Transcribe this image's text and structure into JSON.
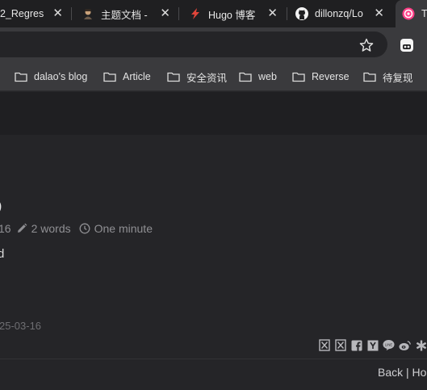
{
  "tabs": [
    {
      "title": "2_Regres",
      "favicon": "none"
    },
    {
      "title": "主题文档 - ",
      "favicon": "avatar-icon"
    },
    {
      "title": "Hugo 博客",
      "favicon": "bolt-icon"
    },
    {
      "title": "dillonzq/Lo",
      "favicon": "github-icon"
    },
    {
      "title": "T",
      "favicon": "hugo-icon"
    }
  ],
  "bookmarks": [
    {
      "label": "dalao's blog"
    },
    {
      "label": "Article"
    },
    {
      "label": "安全资讯"
    },
    {
      "label": "web"
    },
    {
      "label": "Reverse"
    },
    {
      "label": "待复现"
    }
  ],
  "post": {
    "title_fragment": ")",
    "meta": {
      "date_fragment": "16",
      "words": "2 words",
      "reading_time": "One minute"
    },
    "body_fragment": "d",
    "updated_fragment": "25-03-16"
  },
  "footer": {
    "nav_text": "Back | Ho"
  },
  "colors": {
    "background": "#252528",
    "tabstrip": "#1f1f21",
    "toolbar": "#3a3a3d",
    "muted_text": "#8f8f93"
  }
}
